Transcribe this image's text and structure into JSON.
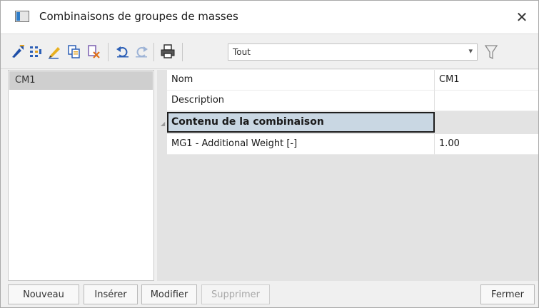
{
  "window": {
    "title": "Combinaisons de groupes de masses",
    "close_glyph": "✕"
  },
  "toolbar": {
    "icons": [
      "new-item-icon",
      "columns-icon",
      "edit-pencil-icon",
      "copy-icon",
      "delete-icon",
      "undo-icon",
      "redo-icon",
      "print-icon"
    ],
    "filter": {
      "selected": "Tout",
      "arrow": "▾"
    },
    "filter_icon": "funnel-icon"
  },
  "list": {
    "items": [
      {
        "label": "CM1",
        "selected": true
      }
    ]
  },
  "properties": {
    "rows": [
      {
        "name": "Nom",
        "value": "CM1"
      },
      {
        "name": "Description",
        "value": ""
      }
    ],
    "category": {
      "label": "Contenu de la combinaison",
      "expander": "◢"
    },
    "items": [
      {
        "name": "MG1 - Additional Weight [-]",
        "value": "1.00"
      }
    ]
  },
  "buttons": {
    "new": "Nouveau",
    "insert": "Insérer",
    "modify": "Modifier",
    "delete": "Supprimer",
    "close": "Fermer"
  },
  "colors": {
    "selection": "#cfcfcf",
    "category_bg": "#c9d7e3",
    "accent_blue": "#2f7cc7"
  }
}
